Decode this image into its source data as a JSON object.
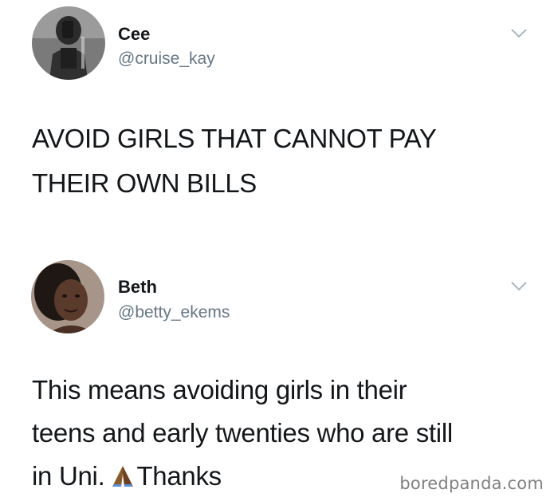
{
  "tweets": [
    {
      "name": "Cee",
      "handle": "@cruise_kay",
      "lines": [
        "AVOID GIRLS THAT CANNOT PAY",
        "THEIR OWN BILLS"
      ]
    },
    {
      "name": "Beth",
      "handle": "@betty_ekems",
      "lines": [
        "This means avoiding girls in their",
        "teens and early twenties who are still",
        "in Uni.",
        "Thanks"
      ],
      "emoji": "folded-hands"
    }
  ],
  "watermark": "boredpanda.com",
  "icons": {
    "chevron": "chevron-down-icon",
    "prayer": "folded-hands-icon"
  },
  "colors": {
    "text": "#14171a",
    "handle": "#657786",
    "chevron": "#aab8c2",
    "watermark": "#7f7f7f"
  }
}
